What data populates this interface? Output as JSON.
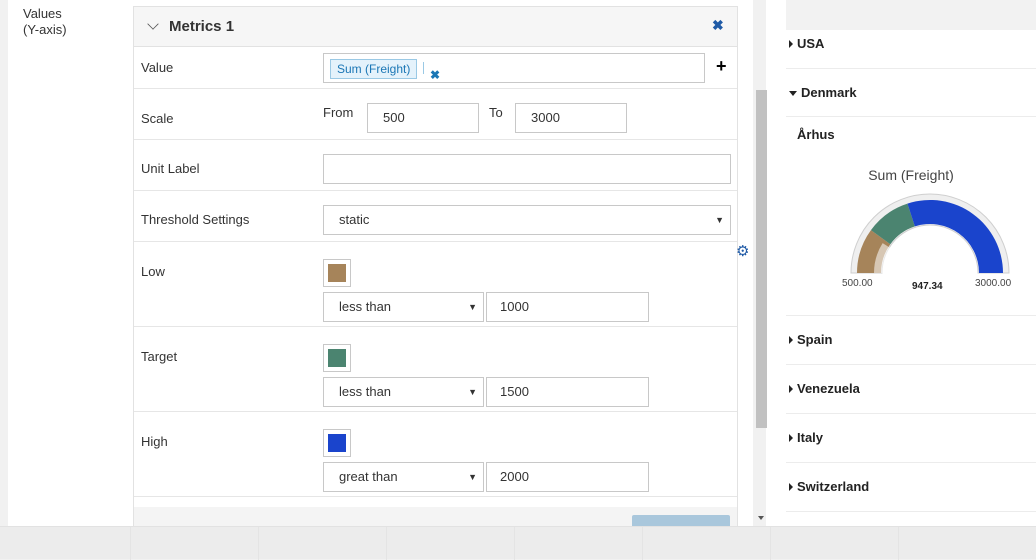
{
  "side": {
    "values_label": "Values",
    "axis_label": "(Y-axis)"
  },
  "panel": {
    "title": "Metrics 1",
    "close_icon": "✖"
  },
  "value_row": {
    "label": "Value",
    "tag": "Sum (Freight)",
    "tag_remove_icon": "✖",
    "add_icon": "+"
  },
  "scale_row": {
    "label": "Scale",
    "from_label": "From",
    "from_value": "500",
    "to_label": "To",
    "to_value": "3000"
  },
  "unit_row": {
    "label": "Unit Label",
    "value": ""
  },
  "threshold_row": {
    "label": "Threshold Settings",
    "value": "static"
  },
  "thresholds": [
    {
      "label": "Low",
      "color": "#a6845a",
      "operator": "less than",
      "value": "1000"
    },
    {
      "label": "Target",
      "color": "#4b8470",
      "operator": "less than",
      "value": "1500"
    },
    {
      "label": "High",
      "color": "#1a44cc",
      "operator": "great than",
      "value": "2000"
    }
  ],
  "add_button_label": "",
  "preview": {
    "countries": [
      {
        "name": "USA",
        "expanded": false
      },
      {
        "name": "Denmark",
        "expanded": true
      },
      {
        "name": "Spain",
        "expanded": false
      },
      {
        "name": "Venezuela",
        "expanded": false
      },
      {
        "name": "Italy",
        "expanded": false
      },
      {
        "name": "Switzerland",
        "expanded": false
      }
    ],
    "city": "Århus",
    "gauge": {
      "title": "Sum (Freight)",
      "min_label": "500.00",
      "value_label": "947.34",
      "max_label": "3000.00",
      "min": 500,
      "max": 3000,
      "value": 947.34,
      "bands": [
        {
          "from": 500,
          "to": 1000,
          "color": "#a6845a"
        },
        {
          "from": 1000,
          "to": 1500,
          "color": "#4b8470"
        },
        {
          "from": 1500,
          "to": 3000,
          "color": "#1a44cc"
        }
      ],
      "track_color": "#efefef"
    }
  }
}
